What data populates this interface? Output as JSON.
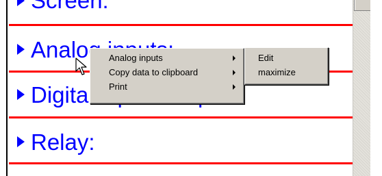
{
  "sections": [
    {
      "label": "Screen:"
    },
    {
      "label": "Analog inputs:"
    },
    {
      "label": "Digital inputs/outputs:"
    },
    {
      "label": "Relay:"
    }
  ],
  "context_menu": {
    "items": [
      {
        "label": "Analog inputs",
        "has_submenu": true
      },
      {
        "label": "Copy data to clipboard",
        "has_submenu": true
      },
      {
        "label": "Print",
        "has_submenu": true
      }
    ]
  },
  "submenu": {
    "items": [
      {
        "label": "Edit"
      },
      {
        "label": "maximize"
      }
    ]
  },
  "colors": {
    "section_text": "#0000ff",
    "divider": "#ff0000",
    "menu_bg": "#d4d0c8"
  },
  "icons": [
    "expand-arrow-icon",
    "submenu-arrow-icon",
    "mouse-pointer-icon"
  ]
}
